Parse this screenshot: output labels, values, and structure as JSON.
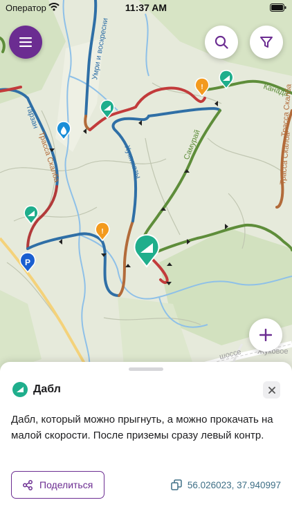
{
  "status_bar": {
    "carrier": "Оператор",
    "time": "11:37 AM"
  },
  "map": {
    "trail_labels": [
      "Умри и воскресни",
      "Тарзан",
      "Трасса Скалба",
      "Хумиказы",
      "Самурай",
      "Канада",
      "Трасса Скалба",
      "Трасса Скалба"
    ],
    "road_labels": [
      "шоссе",
      "Жуковое"
    ]
  },
  "buttons": {
    "menu_icon": "hamburger-icon",
    "search_icon": "search-icon",
    "filter_icon": "filter-icon",
    "add_icon": "plus-icon"
  },
  "feature": {
    "title": "Дабл",
    "description": "Дабл, который можно прыгнуть, а можно прокачать на малой скорости. После приземы сразу левый контр.",
    "share_label": "Поделиться",
    "coordinates": "56.026023, 37.940997"
  },
  "colors": {
    "accent": "#6b2c91",
    "marker_green": "#1fae8c",
    "marker_orange": "#f39a1e",
    "marker_blue": "#1a5fd0",
    "coords_text": "#3e6f86"
  }
}
